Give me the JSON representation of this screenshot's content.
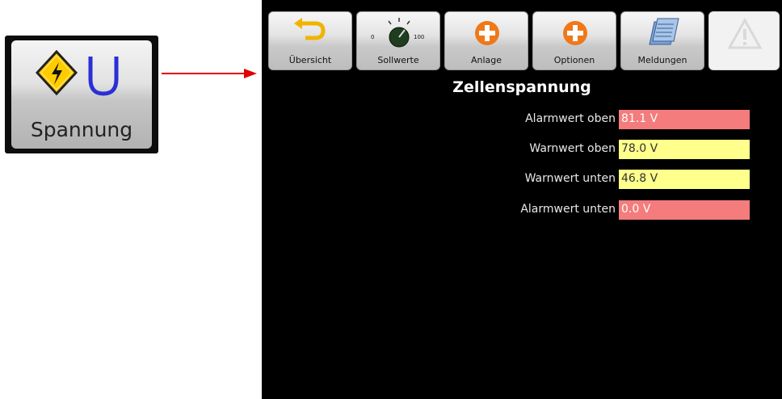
{
  "tile": {
    "label": "Spannung",
    "icons": [
      "high-voltage-icon",
      "voltage-u-icon"
    ]
  },
  "toolbar": {
    "buttons": [
      {
        "label": "Übersicht",
        "icon": "back-arrow-icon"
      },
      {
        "label": "Sollwerte",
        "icon": "dial-knob-icon",
        "dial_min": "0",
        "dial_max": "100"
      },
      {
        "label": "Anlage",
        "icon": "plus-circle-icon"
      },
      {
        "label": "Optionen",
        "icon": "plus-circle-icon"
      },
      {
        "label": "Meldungen",
        "icon": "documents-icon"
      },
      {
        "label": "",
        "icon": "warning-icon"
      }
    ]
  },
  "page": {
    "title": "Zellenspannung"
  },
  "rows": [
    {
      "label": "Alarmwert oben",
      "value": "81.1 V",
      "status": "alarm"
    },
    {
      "label": "Warnwert oben",
      "value": "78.0 V",
      "status": "warn"
    },
    {
      "label": "Warnwert unten",
      "value": "46.8 V",
      "status": "warn"
    },
    {
      "label": "Alarmwert unten",
      "value": "0.0 V",
      "status": "alarm"
    }
  ],
  "colors": {
    "alarm": "#f47c7c",
    "warn": "#ffff8c",
    "arrow": "#e00000",
    "voltage_u": "#2a2fd6",
    "warning_yellow": "#ffcc00"
  }
}
